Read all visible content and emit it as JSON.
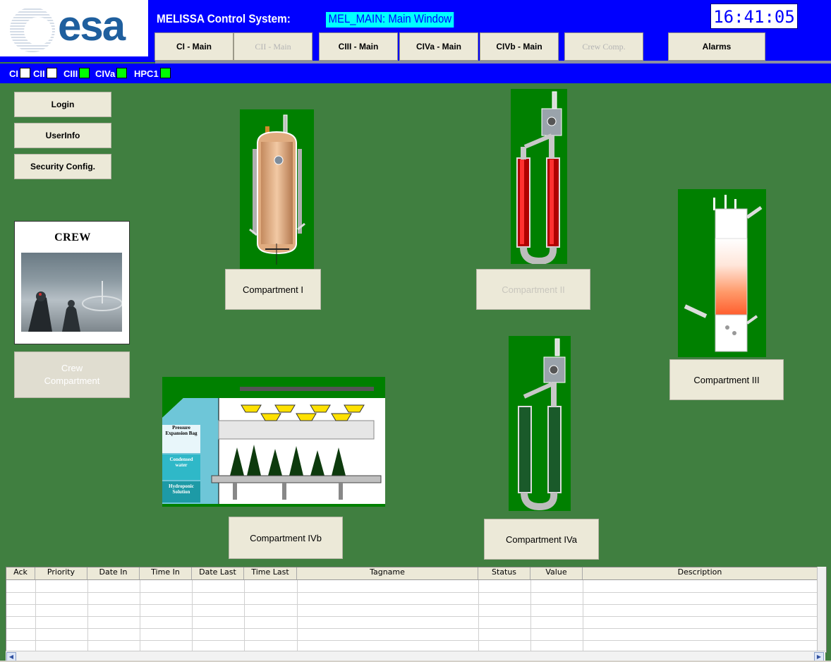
{
  "header": {
    "logo_text": "esa",
    "app_title": "MELISSA Control System:",
    "window_name": "MEL_MAIN: Main Window",
    "clock": "16:41:05",
    "brand_color": "#0000ff"
  },
  "nav": [
    {
      "label": "CI - Main",
      "enabled": true
    },
    {
      "label": "CII - Main",
      "enabled": false
    },
    {
      "label": "CIII - Main",
      "enabled": true
    },
    {
      "label": "CIVa - Main",
      "enabled": true
    },
    {
      "label": "CIVb - Main",
      "enabled": true
    },
    {
      "label": "Crew Comp.",
      "enabled": false
    },
    {
      "label": "Alarms",
      "enabled": true
    }
  ],
  "status": [
    {
      "label": "CI",
      "color": "#ffffff"
    },
    {
      "label": "CII",
      "color": "#ffffff"
    },
    {
      "label": "CIII",
      "color": "#00ff00"
    },
    {
      "label": "CIVa",
      "color": "#00ff00"
    },
    {
      "label": "HPC1",
      "color": "#00ff00"
    }
  ],
  "side_buttons": {
    "login": "Login",
    "userinfo": "UserInfo",
    "security": "Security Config."
  },
  "crew": {
    "title": "CREW",
    "button_line1": "Crew",
    "button_line2": "Compartment"
  },
  "compartments": {
    "c1": "Compartment I",
    "c2": "Compartment II",
    "c3": "Compartment III",
    "c4a": "Compartment IVa",
    "c4b": "Compartment IVb"
  },
  "plant_labels": {
    "bag": "Pressure Expansion Bag",
    "water": "Condensed water",
    "hydro": "Hydroponic Solution"
  },
  "alarm_table": {
    "columns": [
      "Ack",
      "Priority",
      "Date In",
      "Time In",
      "Date Last",
      "Time Last",
      "Tagname",
      "Status",
      "Value",
      "Description"
    ]
  }
}
